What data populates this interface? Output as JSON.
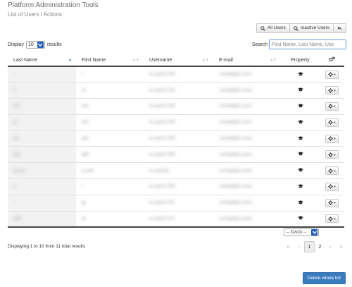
{
  "app": {
    "title": "Platform Administration Tools",
    "subtitle": "List of Users / Actions"
  },
  "top_actions": {
    "all_users": "All Users",
    "inactive_users": "Inactive Users"
  },
  "display": {
    "prefix": "Display",
    "value": "10",
    "suffix": "results"
  },
  "search": {
    "label": "Search",
    "placeholder": "First Name, Last Name, Use"
  },
  "table": {
    "headers": [
      "Last Name",
      "First Name",
      "Username",
      "E-mail",
      "Property"
    ],
    "rows": [
      {
        "last": "l",
        "first": "l",
        "username": "lu.user1730",
        "email": "l.email@o.com",
        "property": "teacher"
      },
      {
        "last": "ll",
        "first": "nl",
        "username": "lu.user1730",
        "email": "l.email@o.com",
        "property": "teacher"
      },
      {
        "last": "aN",
        "first": "Ivd",
        "username": "lu.user1740",
        "email": "l.email@o.com",
        "property": "teacher"
      },
      {
        "last": "ai",
        "first": "aiV",
        "username": "lu.user1749",
        "email": "l.email@o.com",
        "property": "teacher"
      },
      {
        "last": "aii",
        "first": "aiV",
        "username": "lu.user1749",
        "email": "l.email@o.com",
        "property": "teacher"
      },
      {
        "last": "aiiii",
        "first": "ailll",
        "username": "lu.user1760",
        "email": "l.email@o.com",
        "property": "teacher"
      },
      {
        "last": "ta.lux",
        "first": "lu.aril",
        "username": "lu.user61",
        "email": "l.email@o.com",
        "property": "teacher"
      },
      {
        "last": "a",
        "first": "l",
        "username": "lu.user1750",
        "email": "l.email@o.com",
        "property": "teacher"
      },
      {
        "last": "l",
        "first": "lg",
        "username": "lu.user1757",
        "email": "l.email@o.com",
        "property": "teacher"
      },
      {
        "last": "aMI",
        "first": "af",
        "username": "lu.user1727",
        "email": "l.email@o.com",
        "property": "teacher"
      }
    ]
  },
  "language_select": "-- ΌΛΟι --",
  "footer": {
    "summary": "Displaying 1 to 10 from 11 total results"
  },
  "pagination": {
    "pages": [
      "1",
      "2"
    ],
    "current": "1"
  },
  "delete_button": "Delete whole list"
}
